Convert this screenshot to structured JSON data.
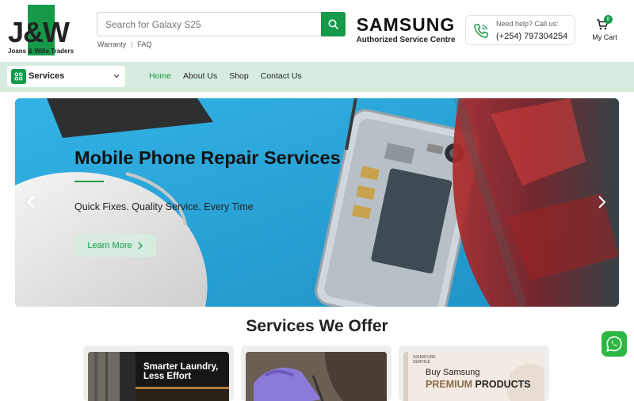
{
  "brand": {
    "logo_text": "J&W",
    "logo_sub": "Joans & Wills Traders"
  },
  "search": {
    "placeholder": "Search for Galaxy S25",
    "button_icon": "search-icon"
  },
  "top_links": [
    "Warranty",
    "FAQ"
  ],
  "partner": {
    "name": "SAMSUNG",
    "tagline": "Authorized Service Centre"
  },
  "help": {
    "label": "Need help? Call us:",
    "phone": "(+254) 797304254",
    "icon": "phone-icon"
  },
  "cart": {
    "count": "0",
    "label": "My Cart",
    "icon": "cart-icon"
  },
  "nav": {
    "services_label": "Services",
    "links": [
      "Home",
      "About Us",
      "Shop",
      "Contact Us"
    ],
    "active": "Home"
  },
  "hero": {
    "title": "Mobile Phone Repair Services",
    "subtitle": "Quick Fixes. Quality Service. Every Time",
    "cta": "Learn More"
  },
  "services": {
    "heading": "Services We Offer",
    "cards": [
      {
        "line1": "Smarter Laundry,",
        "line2": "Less Effort"
      },
      {
        "line1": "",
        "line2": ""
      },
      {
        "line1": "Buy Samsung",
        "line2a": "PREMIUM",
        "line2b": " PRODUCTS",
        "logo1": "SIGNATURE",
        "logo2": "SERVICE"
      }
    ]
  },
  "colors": {
    "accent": "#169a4a",
    "nav_bg": "#d6ecdf",
    "whatsapp": "#2db742"
  }
}
